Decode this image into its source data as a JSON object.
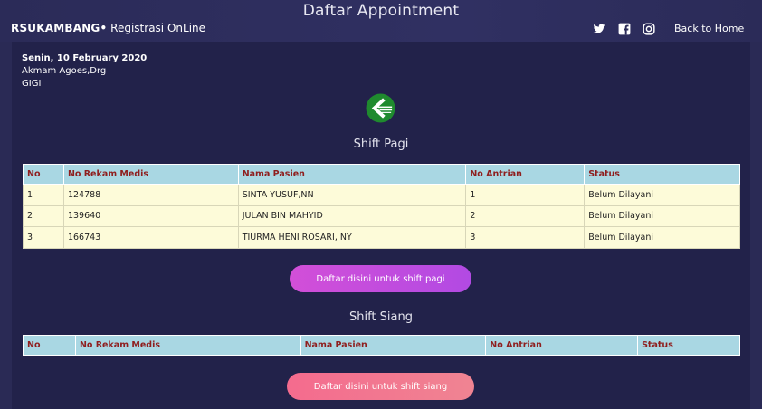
{
  "header": {
    "title": "Daftar Appointment",
    "brand_bold": "RSUKAMBANG•",
    "brand_rest": " Registrasi OnLine",
    "back_home": "Back to Home",
    "social_icons": [
      "twitter-icon",
      "facebook-icon",
      "instagram-icon"
    ]
  },
  "appointment": {
    "date": "Senin, 10 February 2020",
    "doctor": "Akmam Agoes,Drg",
    "clinic": "GIGI"
  },
  "shift_pagi": {
    "title": "Shift Pagi",
    "columns": [
      "No",
      "No Rekam Medis",
      "Nama Pasien",
      "No Antrian",
      "Status"
    ],
    "rows": [
      [
        "1",
        "124788",
        "SINTA YUSUF,NN",
        "1",
        "Belum Dilayani"
      ],
      [
        "2",
        "139640",
        "JULAN BIN MAHYID",
        "2",
        "Belum Dilayani"
      ],
      [
        "3",
        "166743",
        "TIURMA HENI ROSARI, NY",
        "3",
        "Belum Dilayani"
      ]
    ],
    "button": "Daftar disini untuk shift pagi"
  },
  "shift_siang": {
    "title": "Shift Siang",
    "columns": [
      "No",
      "No Rekam Medis",
      "Nama Pasien",
      "No Antrian",
      "Status"
    ],
    "rows": [],
    "button": "Daftar disini untuk shift siang"
  },
  "colors": {
    "background": "#2a2a55",
    "table_header": "#a9d7e3",
    "table_header_text": "#8f1e1e",
    "row_background": "#fdfbd9",
    "button_pagi": "#c94ddd",
    "button_siang": "#f27590",
    "logo_green": "#1f8a2e"
  }
}
